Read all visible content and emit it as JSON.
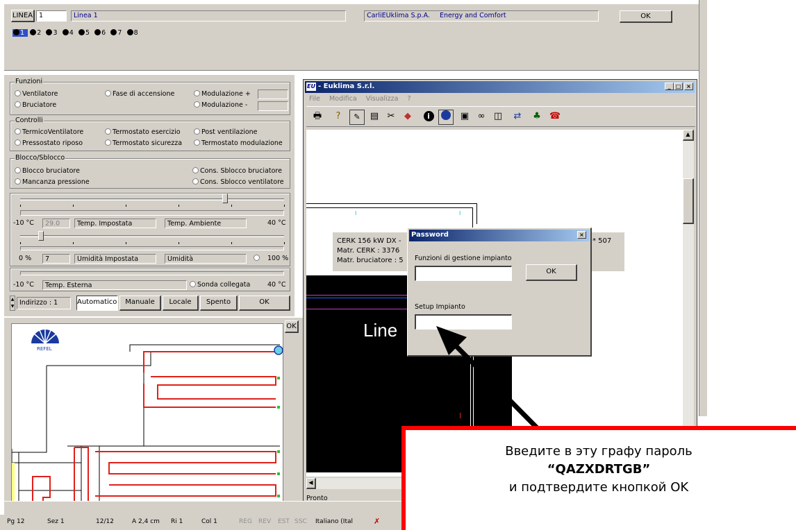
{
  "top": {
    "line_label": "LINEA",
    "line_number": "1",
    "line_name": "Linea 1",
    "company": "CarliEUklima S.p.A.",
    "slogan": "Energy and Comfort",
    "ok": "OK",
    "dots": [
      "1",
      "2",
      "3",
      "4",
      "5",
      "6",
      "7",
      "8"
    ]
  },
  "panel": {
    "funzioni": {
      "title": "Funzioni",
      "ventilatore": "Ventilatore",
      "bruciatore": "Bruciatore",
      "fase": "Fase di accensione",
      "mod_plus": "Modulazione +",
      "mod_minus": "Modulazione -"
    },
    "controlli": {
      "title": "Controlli",
      "items": [
        "TermicoVentilatore",
        "Termostato esercizio",
        "Post ventilazione",
        "Pressostato riposo",
        "Termostato sicurezza",
        "Termostato modulazione"
      ]
    },
    "blocco": {
      "title": "Blocco/Sblocco",
      "items": [
        "Blocco bruciatore",
        "Cons. Sblocco bruciatore",
        "Mancanza pressione",
        "Cons. Sblocco ventilatore"
      ]
    },
    "temp": {
      "min": "-10 °C",
      "value": "29.0",
      "set_label": "Temp. Impostata",
      "amb_label": "Temp. Ambiente",
      "max": "40 °C"
    },
    "humid": {
      "min": "0 %",
      "value": "7",
      "set_label": "Umidità Impostata",
      "label": "Umidità",
      "max": "100 %"
    },
    "ext": {
      "min": "-10 °C",
      "label": "Temp. Esterna",
      "probe": "Sonda collegata",
      "max": "40 °C"
    },
    "buttons": {
      "indirizzo": "Indirizzo : 1",
      "auto": "Automatico",
      "manual": "Manuale",
      "local": "Locale",
      "off": "Spento",
      "ok": "OK"
    },
    "plan_ok": "OK",
    "logo": "REFEL"
  },
  "euklima": {
    "title": "- Euklima S.r.l.",
    "menu": [
      "File",
      "Modifica",
      "Visualizza",
      "?"
    ],
    "status": "Pronto",
    "info_line1": "CERK 156 kW DX -",
    "info_line2": "Matr. CERK : 3376",
    "info_line3": "Matr. bruciatore : 5",
    "info_right": "* 507",
    "canvas_text": "Line"
  },
  "dialog": {
    "title": "Password",
    "label1": "Funzioni di gestione impianto",
    "ok": "OK",
    "label2": "Setup Impianto"
  },
  "callout": {
    "line1": "Введите в эту графу пароль",
    "password": "“QAZXDRTGB”",
    "line3": "и подтвердите кнопкой OK"
  },
  "statusbar": {
    "items": [
      "Pg 12",
      "Sez 1",
      "12/12",
      "A 2,4 cm",
      "Ri 1",
      "Col 1",
      "REG",
      "REV",
      "EST",
      "SSC",
      "Italiano (Ital"
    ]
  }
}
